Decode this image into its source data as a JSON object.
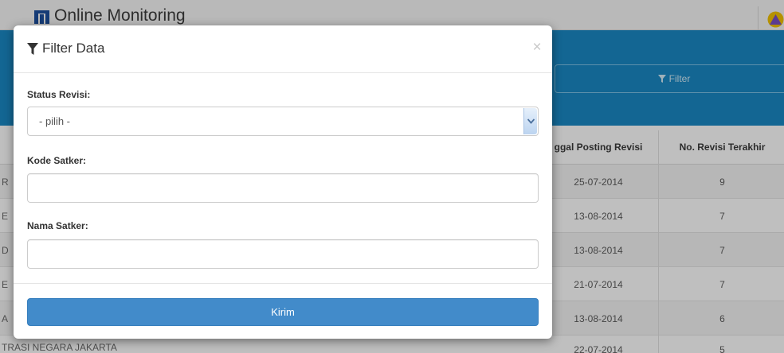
{
  "app": {
    "title": "Online Monitoring"
  },
  "toolbar": {
    "filter_label": "Filter"
  },
  "table": {
    "columns": [
      "ggal Posting Revisi",
      "No. Revisi Terakhir"
    ],
    "rows": [
      {
        "left_fragment": "R",
        "tanggal": "25-07-2014",
        "revisi": "9"
      },
      {
        "left_fragment": "E",
        "tanggal": "13-08-2014",
        "revisi": "7"
      },
      {
        "left_fragment": "D",
        "tanggal": "13-08-2014",
        "revisi": "7"
      },
      {
        "left_fragment": "E",
        "tanggal": "21-07-2014",
        "revisi": "7"
      },
      {
        "left_fragment": "A",
        "tanggal": "13-08-2014",
        "revisi": "6"
      },
      {
        "left_fragment": "TRASI NEGARA JAKARTA",
        "tanggal": "22-07-2014",
        "revisi": "5"
      }
    ]
  },
  "modal": {
    "title": "Filter Data",
    "close_symbol": "×",
    "status_label": "Status Revisi:",
    "status_selected": "- pilih -",
    "kode_label": "Kode Satker:",
    "kode_value": "",
    "nama_label": "Nama Satker:",
    "nama_value": "",
    "submit_label": "Kirim"
  },
  "icons": {
    "logo": "grid-logo-icon",
    "filter": "funnel-icon",
    "close": "close-icon",
    "select_arrow": "chevron-down-icon",
    "user": "user-avatar-icon"
  },
  "colors": {
    "band": "#1a89c4",
    "primary_button": "#428bca",
    "logo": "#1c4f9e"
  }
}
